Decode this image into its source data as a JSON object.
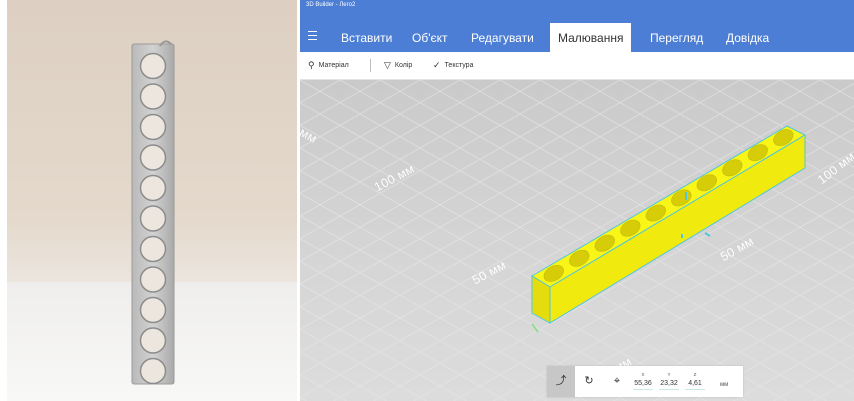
{
  "window": {
    "title": "3D Builder - Лего2"
  },
  "menu": {
    "items": [
      {
        "label": "Вставити",
        "active": false
      },
      {
        "label": "Об'єкт",
        "active": false
      },
      {
        "label": "Редагувати",
        "active": false
      },
      {
        "label": "Малювання",
        "active": true
      },
      {
        "label": "Перегляд",
        "active": false
      },
      {
        "label": "Довідка",
        "active": false
      }
    ]
  },
  "toolbar": {
    "material": "Матеріал",
    "color": "Колір",
    "texture": "Текстура"
  },
  "viewport": {
    "labels": {
      "top_left": "0 мм",
      "left_100": "100 мм",
      "left_50": "50 мм",
      "bottom_0": "0 мм",
      "right_50": "50 мм",
      "right_100": "100 мм"
    },
    "model_color": "#f5f21b",
    "highlight_color": "#4fc7de"
  },
  "bottombar": {
    "x_label": "X",
    "x_value": "55,36",
    "y_label": "Y",
    "y_value": "23,32",
    "z_label": "Z",
    "z_value": "4,61",
    "unit": "мм"
  },
  "colors": {
    "accent": "#4d7ed5"
  }
}
